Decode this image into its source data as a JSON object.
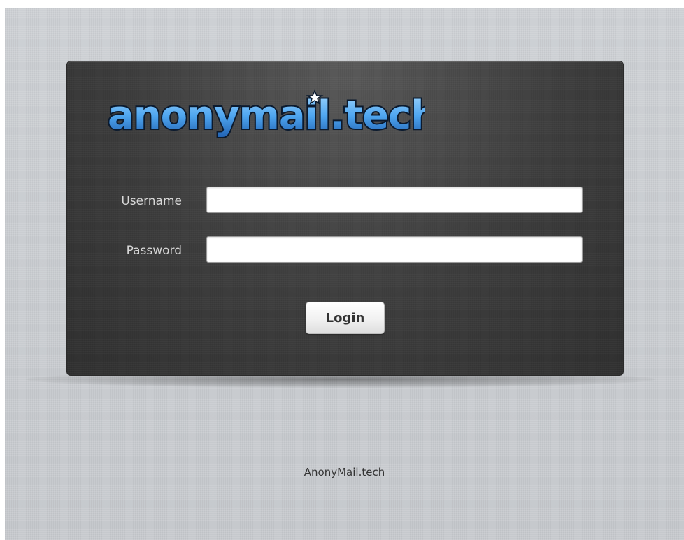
{
  "logo": {
    "text": "anonymail.tech",
    "main_color": "#4fa6f0",
    "outline_color": "#0b1a2e"
  },
  "form": {
    "username_label": "Username",
    "username_value": "",
    "password_label": "Password",
    "password_value": "",
    "login_label": "Login"
  },
  "footer": {
    "text": "AnonyMail.tech"
  },
  "colors": {
    "page_background": "#c9ccd0",
    "panel_background": "#3b3b3b",
    "label_text": "#d8d8d8",
    "footer_text": "#333333"
  }
}
